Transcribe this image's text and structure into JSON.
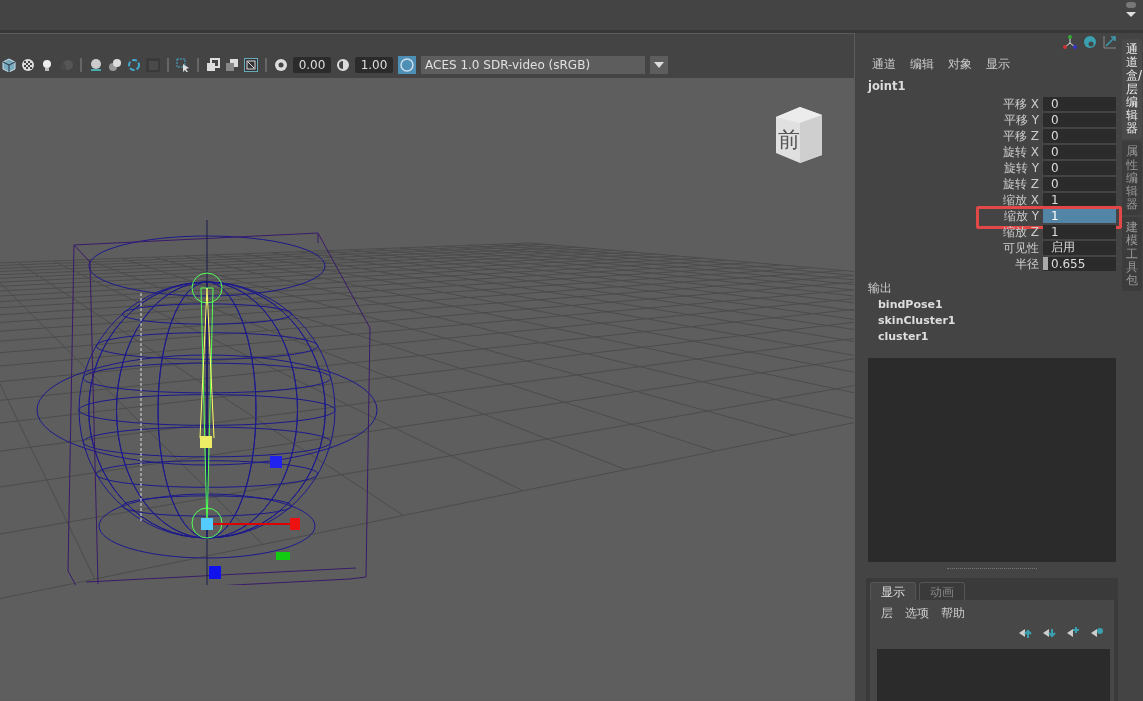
{
  "toolbar": {
    "exposure": "0.00",
    "gamma": "1.00",
    "color_management": true,
    "color_space": "ACES 1.0 SDR-video (sRGB)"
  },
  "view_cube": {
    "label": "前"
  },
  "channel_box": {
    "menu": [
      "通道",
      "编辑",
      "对象",
      "显示"
    ],
    "object": "joint1",
    "channels": [
      {
        "name": "平移 X",
        "value": "0",
        "kind": "field",
        "selected": false,
        "annotated": false
      },
      {
        "name": "平移 Y",
        "value": "0",
        "kind": "field",
        "selected": false,
        "annotated": false
      },
      {
        "name": "平移 Z",
        "value": "0",
        "kind": "field",
        "selected": false,
        "annotated": false
      },
      {
        "name": "旋转 X",
        "value": "0",
        "kind": "field",
        "selected": false,
        "annotated": false
      },
      {
        "name": "旋转 Y",
        "value": "0",
        "kind": "field",
        "selected": false,
        "annotated": false
      },
      {
        "name": "旋转 Z",
        "value": "0",
        "kind": "field",
        "selected": false,
        "annotated": false
      },
      {
        "name": "缩放 X",
        "value": "1",
        "kind": "field",
        "selected": false,
        "annotated": false
      },
      {
        "name": "缩放 Y",
        "value": "1",
        "kind": "field",
        "selected": true,
        "annotated": true
      },
      {
        "name": "缩放 Z",
        "value": "1",
        "kind": "field",
        "selected": false,
        "annotated": false
      },
      {
        "name": "可见性",
        "value": "启用",
        "kind": "field",
        "selected": false,
        "annotated": false
      },
      {
        "name": "半径",
        "value": "0.655",
        "kind": "slider",
        "selected": false,
        "annotated": false
      }
    ],
    "output_label": "输出",
    "outputs": [
      "bindPose1",
      "skinCluster1",
      "cluster1"
    ]
  },
  "layer_editor": {
    "tabs": [
      {
        "label": "显示",
        "selected": true
      },
      {
        "label": "动画",
        "selected": false
      }
    ],
    "menu": [
      "层",
      "选项",
      "帮助"
    ]
  },
  "side_tabs": [
    {
      "label": "通道盒/层编辑器",
      "selected": true
    },
    {
      "label": "属性编辑器",
      "selected": false
    },
    {
      "label": "建模工具包",
      "selected": false
    }
  ]
}
